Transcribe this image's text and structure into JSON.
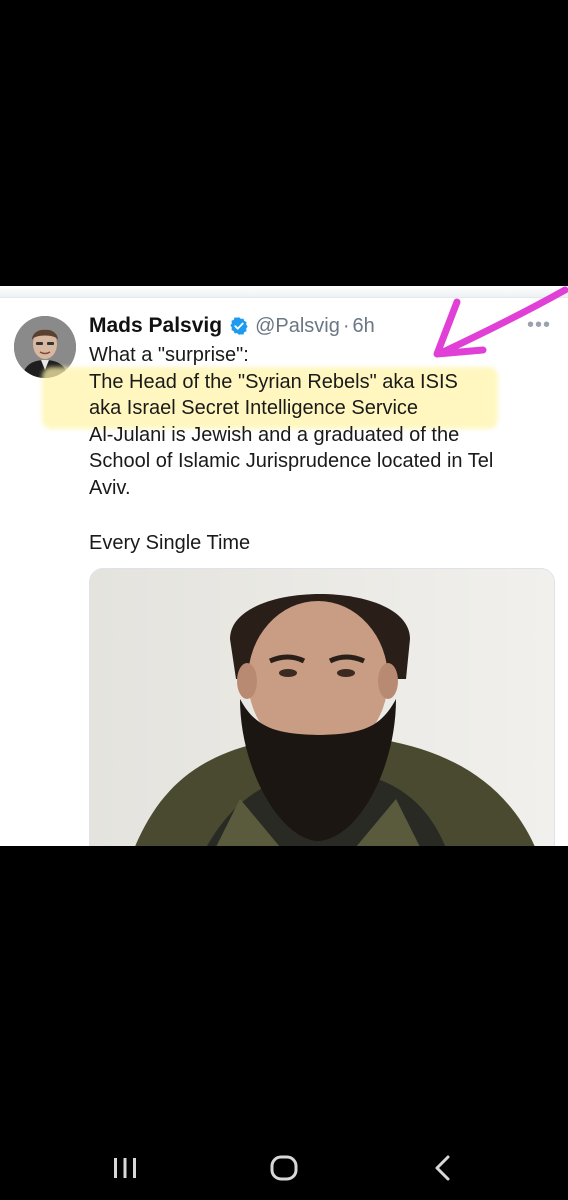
{
  "tweet": {
    "author_name": "Mads Palsvig",
    "handle": "@Palsvig",
    "separator": "·",
    "time_ago": "6h",
    "more_options": "•••",
    "body_lines": [
      "What a \"surprise\":",
      "The Head of the \"Syrian Rebels\" aka ISIS",
      "aka Israel Secret Intelligence Service",
      "Al-Julani is Jewish and a graduated of the",
      "School of Islamic Jurisprudence located in Tel",
      "Aviv."
    ],
    "footer_line": "Every Single Time"
  },
  "colors": {
    "background": "#000000",
    "card": "#ffffff",
    "highlight": "#fff4aa",
    "arrow": "#e040d6",
    "verified": "#1d9bf0",
    "muted_text": "#6b7785"
  },
  "icons": {
    "verified": "verified-badge-icon",
    "annotation": "magenta-arrow",
    "nav_recent": "recent-apps-icon",
    "nav_home": "home-icon",
    "nav_back": "back-chevron-icon"
  }
}
